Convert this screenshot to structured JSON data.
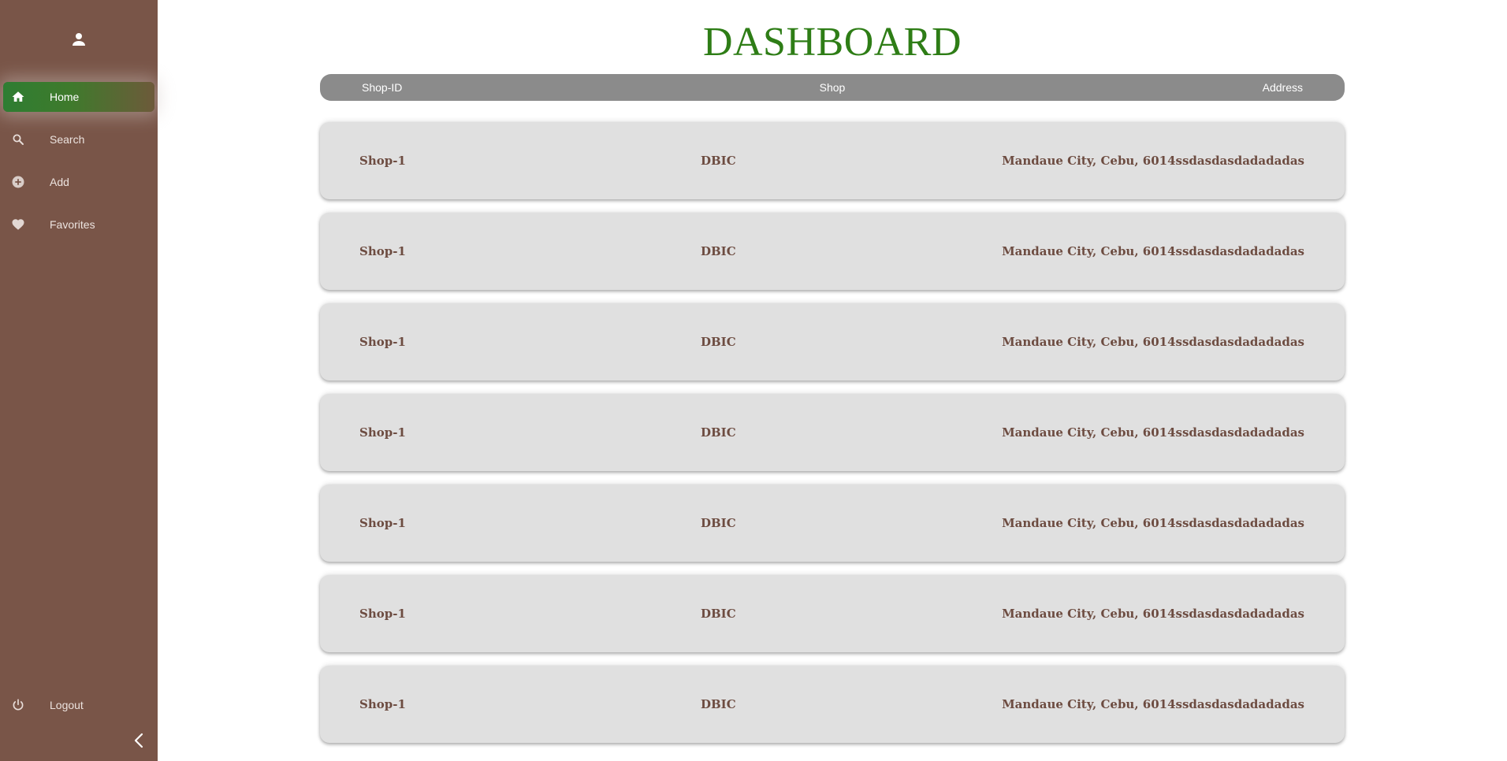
{
  "sidebar": {
    "avatar_icon": "person-icon",
    "items": [
      {
        "label": "Home",
        "icon": "home-icon",
        "active": true
      },
      {
        "label": "Search",
        "icon": "search-icon",
        "active": false
      },
      {
        "label": "Add",
        "icon": "add-circle-icon",
        "active": false
      },
      {
        "label": "Favorites",
        "icon": "heart-icon",
        "active": false
      }
    ],
    "logout": {
      "label": "Logout",
      "icon": "power-icon"
    },
    "collapse_icon": "chevron-left-icon"
  },
  "main": {
    "title": "DASHBOARD",
    "table": {
      "columns": [
        "Shop-ID",
        "Shop",
        "Address"
      ],
      "rows": [
        [
          "Shop-1",
          "DBIC",
          "Mandaue City, Cebu, 6014ssdasdasdadadadas"
        ],
        [
          "Shop-1",
          "DBIC",
          "Mandaue City, Cebu, 6014ssdasdasdadadadas"
        ],
        [
          "Shop-1",
          "DBIC",
          "Mandaue City, Cebu, 6014ssdasdasdadadadas"
        ],
        [
          "Shop-1",
          "DBIC",
          "Mandaue City, Cebu, 6014ssdasdasdadadadas"
        ],
        [
          "Shop-1",
          "DBIC",
          "Mandaue City, Cebu, 6014ssdasdasdadadadas"
        ],
        [
          "Shop-1",
          "DBIC",
          "Mandaue City, Cebu, 6014ssdasdasdadadadas"
        ],
        [
          "Shop-1",
          "DBIC",
          "Mandaue City, Cebu, 6014ssdasdasdadadadas"
        ]
      ]
    }
  },
  "colors": {
    "sidebar_bg": "#795548",
    "accent_green": "#2e7d16",
    "header_gray": "#8b8b8b",
    "row_bg": "#e0e0e0",
    "row_text": "#6d4c41"
  }
}
